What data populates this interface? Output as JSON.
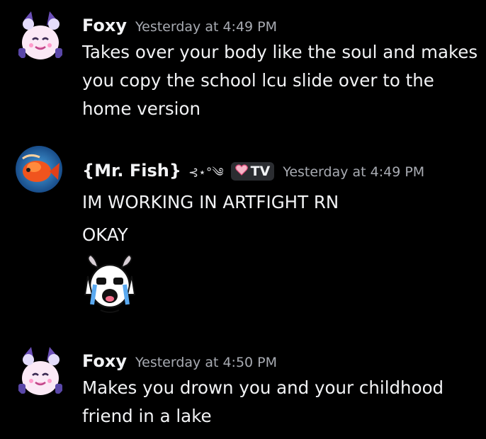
{
  "messages": [
    {
      "username": "Foxy",
      "timestamp": "Yesterday at 4:49 PM",
      "lines": [
        "Takes over your body like the soul and makes",
        "you copy the school lcu slide over to the",
        "home version"
      ]
    },
    {
      "username": "{Mr. Fish}",
      "decoration": "⊰⋆°༄",
      "tag": "TV",
      "timestamp": "Yesterday at 4:49 PM",
      "lines": [
        "IM WORKING IN ARTFIGHT RN",
        "OKAY"
      ],
      "emoji": "crying-goat-emoji"
    },
    {
      "username": "Foxy",
      "timestamp": "Yesterday at 4:50 PM",
      "lines": [
        "Makes you drown you and your childhood",
        "friend in a lake"
      ]
    }
  ],
  "colors": {
    "background": "#000000",
    "text": "#f2f3f5",
    "timestamp": "#a8abb2",
    "tag_bg": "#2b2d31"
  }
}
